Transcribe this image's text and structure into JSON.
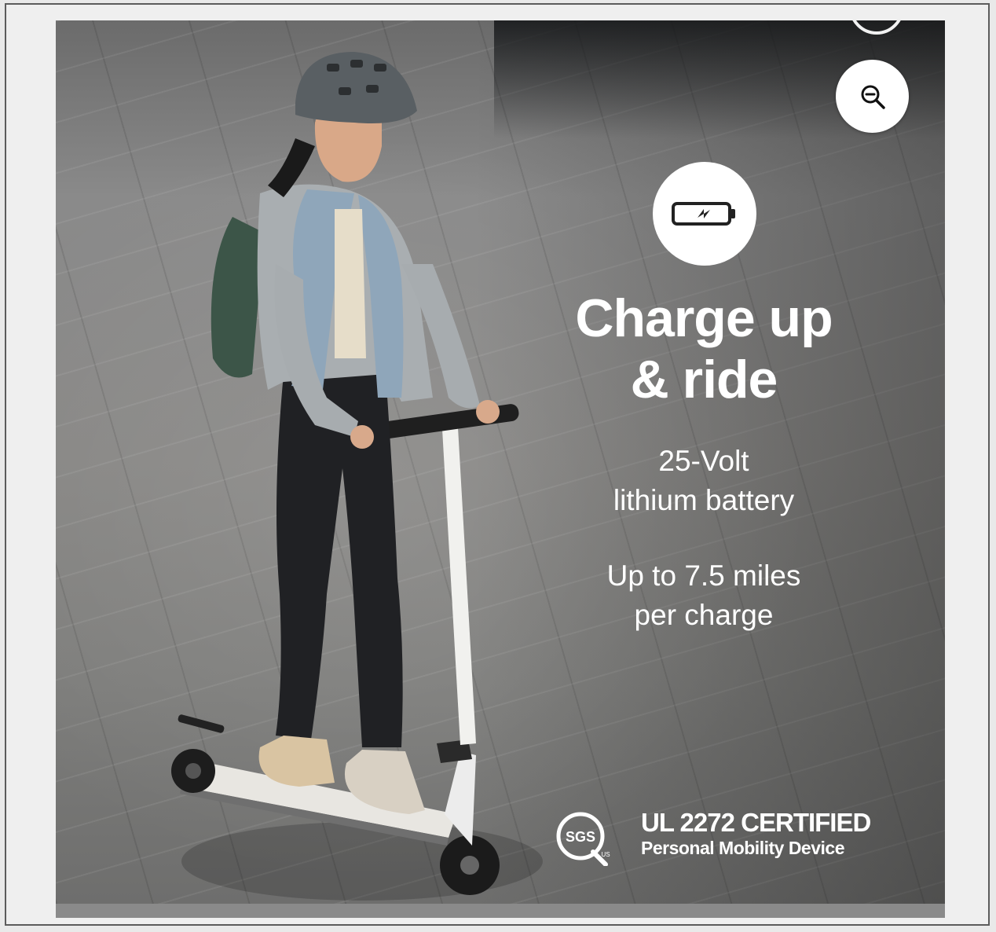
{
  "hero": {
    "headline_line1": "Charge up",
    "headline_line2": "& ride",
    "battery_line1": "25-Volt",
    "battery_line2": "lithium battery",
    "range_line1": "Up to 7.5 miles",
    "range_line2": "per charge"
  },
  "certification": {
    "logo_text": "SGS",
    "logo_region": "US",
    "title": "UL 2272 CERTIFIED",
    "subtitle": "Personal Mobility Device"
  },
  "icons": {
    "zoom": "zoom-out-icon",
    "battery": "battery-charging-icon"
  },
  "colors": {
    "overlay_text": "#ffffff",
    "pavement": "#878684"
  }
}
